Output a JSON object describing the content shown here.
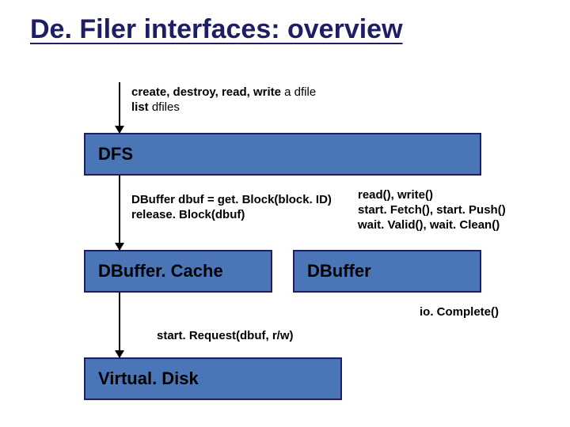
{
  "title": "De. Filer interfaces: overview",
  "text_top": {
    "line1_bold": "create, destroy, read, write ",
    "line1_rest": "a dfile",
    "line2_bold": "list ",
    "line2_rest": "dfiles"
  },
  "box_dfs": "DFS",
  "text_mid_left": {
    "line1": "DBuffer dbuf = get. Block(block. ID)",
    "line2": "release. Block(dbuf)"
  },
  "text_mid_right": {
    "line1": "read(), write()",
    "line2": "start. Fetch(), start. Push()",
    "line3": "wait. Valid(), wait. Clean()"
  },
  "box_dbuffer_cache": "DBuffer. Cache",
  "box_dbuffer": "DBuffer",
  "text_io_complete": "io. Complete()",
  "text_start_request": "start. Request(dbuf, r/w)",
  "box_virtual_disk": "Virtual. Disk"
}
